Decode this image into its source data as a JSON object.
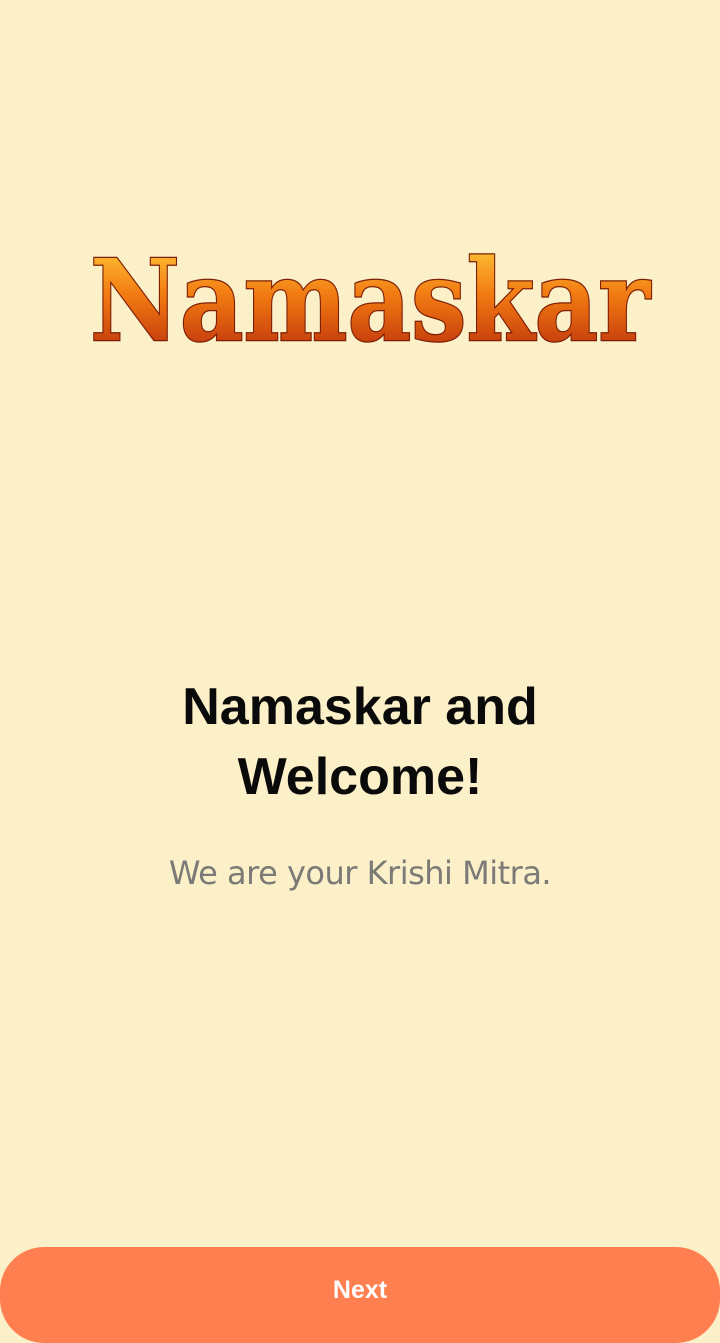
{
  "logo": {
    "text": "Namaskar",
    "colors": {
      "fill_top": "#ffd23c",
      "fill_mid": "#f27a12",
      "fill_bottom": "#b3230a",
      "outline": "#7a1e05"
    }
  },
  "welcome": {
    "title": "Namaskar and Welcome!",
    "subtitle": "We are your Krishi Mitra."
  },
  "actions": {
    "next_label": "Next"
  },
  "theme": {
    "background": "#fcf0c8",
    "button_color": "#ff7f50",
    "title_color": "#0a0a0a",
    "subtitle_color": "#7c7a76"
  }
}
